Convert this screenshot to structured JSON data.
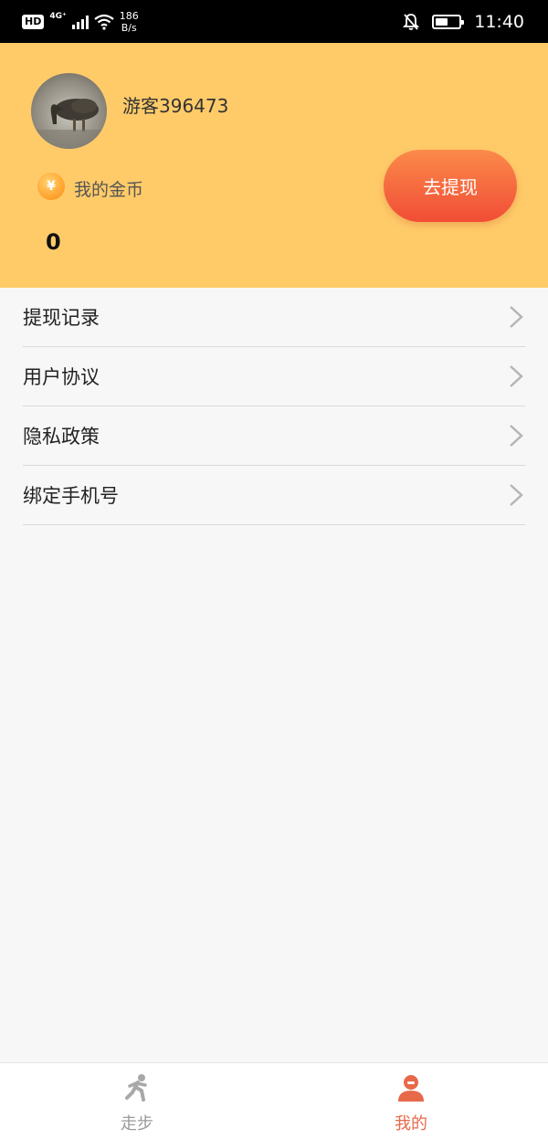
{
  "status_bar": {
    "hd": "HD",
    "network": "4G⁺",
    "speed_value": "186",
    "speed_unit": "B/s",
    "time": "11:40",
    "battery_level": 0.55
  },
  "profile": {
    "username": "游客396473",
    "coin_label": "我的金币",
    "coin_symbol": "¥",
    "coin_value": "0",
    "withdraw_label": "去提现"
  },
  "menu": {
    "items": [
      {
        "label": "提现记录"
      },
      {
        "label": "用户协议"
      },
      {
        "label": "隐私政策"
      },
      {
        "label": "绑定手机号"
      }
    ]
  },
  "tab_bar": {
    "tabs": [
      {
        "label": "走步",
        "icon": "walk-icon",
        "active": false
      },
      {
        "label": "我的",
        "icon": "user-icon",
        "active": true
      }
    ],
    "active_color": "#e8694a",
    "inactive_color": "#9a9a9a"
  },
  "colors": {
    "header_bg": "#ffcb69",
    "button_gradient_top": "#fb8a4a",
    "button_gradient_bottom": "#f14d36"
  }
}
